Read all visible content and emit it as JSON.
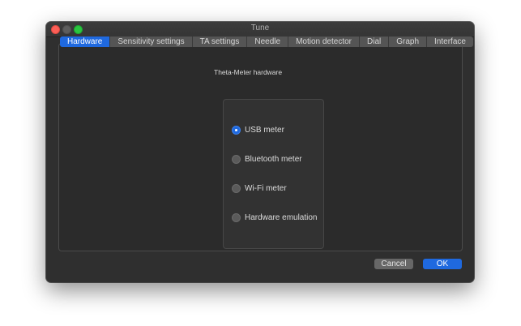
{
  "window": {
    "title": "Tune"
  },
  "tabs": [
    {
      "label": "Hardware",
      "active": true
    },
    {
      "label": "Sensitivity settings",
      "active": false
    },
    {
      "label": "TA settings",
      "active": false
    },
    {
      "label": "Needle",
      "active": false
    },
    {
      "label": "Motion detector",
      "active": false
    },
    {
      "label": "Dial",
      "active": false
    },
    {
      "label": "Graph",
      "active": false
    },
    {
      "label": "Interface",
      "active": false
    }
  ],
  "hardware_group": {
    "label": "Theta-Meter hardware",
    "options": [
      {
        "label": "USB meter",
        "selected": true
      },
      {
        "label": "Bluetooth meter",
        "selected": false
      },
      {
        "label": "Wi-Fi meter",
        "selected": false
      },
      {
        "label": "Hardware emulation",
        "selected": false
      }
    ]
  },
  "buttons": {
    "cancel": "Cancel",
    "ok": "OK"
  },
  "colors": {
    "accent": "#1f69df",
    "close": "#fc5f57",
    "zoom": "#2ac63f",
    "window_bg": "#2f2f2f"
  }
}
